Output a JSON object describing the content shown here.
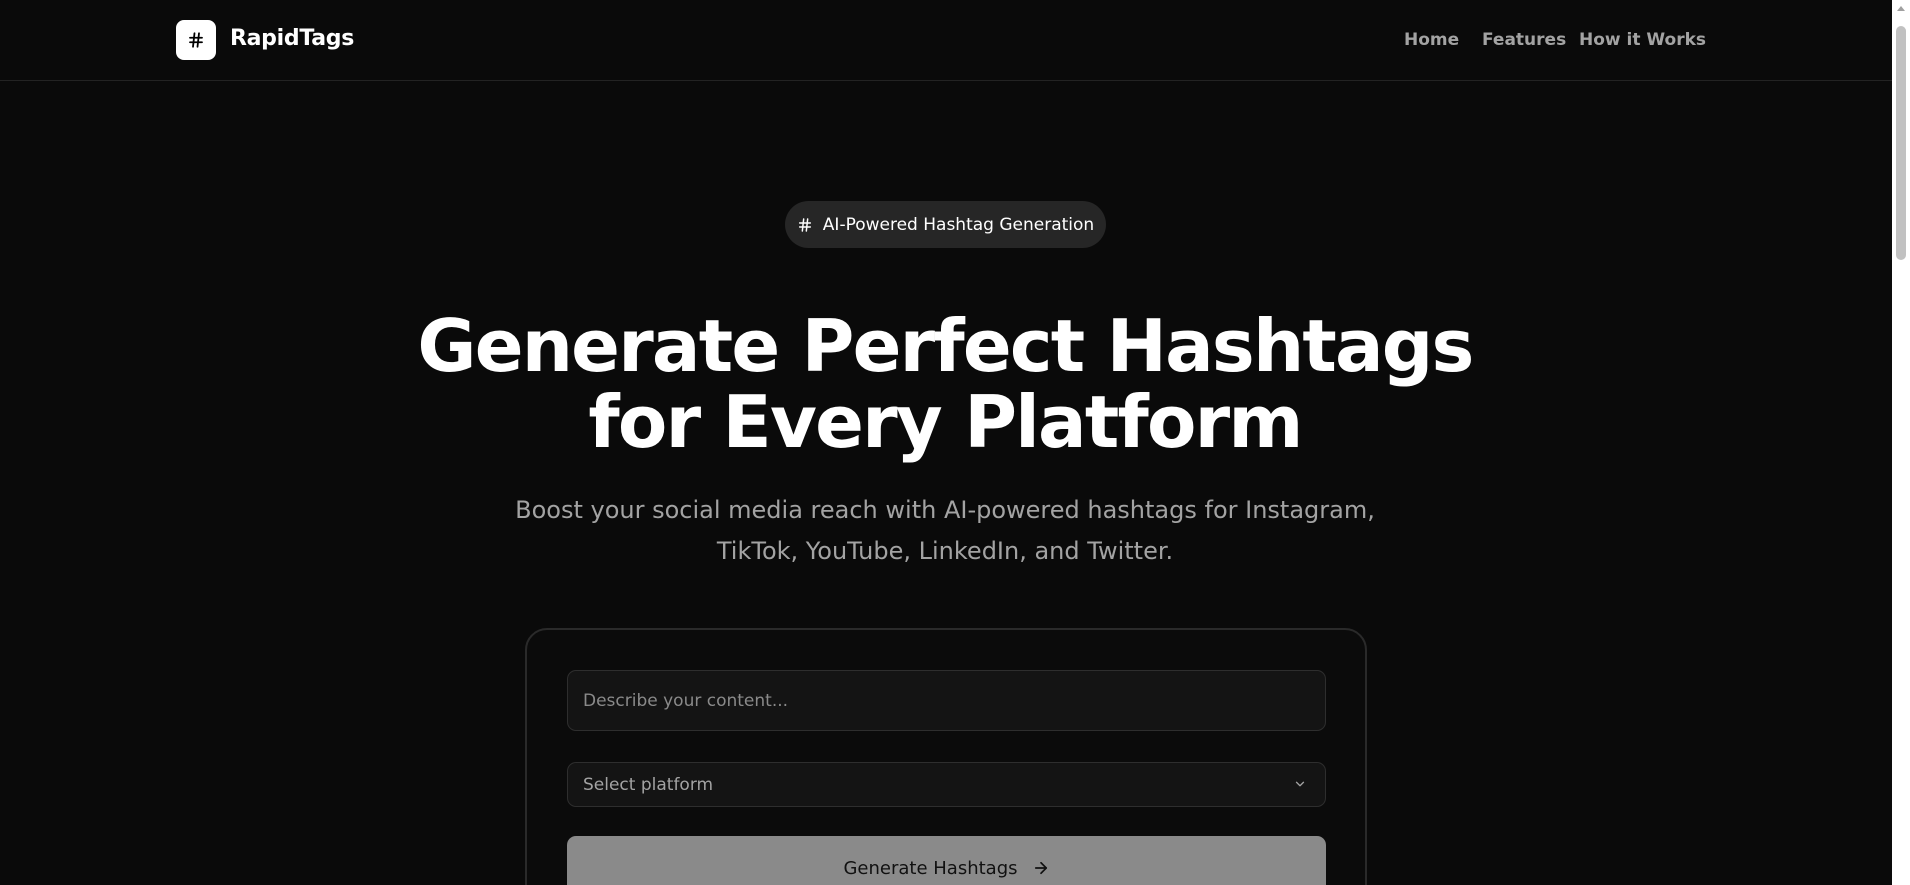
{
  "header": {
    "brand": "RapidTags",
    "logo_icon": "hash-icon",
    "nav": [
      {
        "label": "Home"
      },
      {
        "label": "Features"
      },
      {
        "label": "How it Works"
      }
    ]
  },
  "badge": {
    "icon": "hash-icon",
    "label": "AI-Powered Hashtag Generation"
  },
  "hero": {
    "title_line1": "Generate Perfect Hashtags",
    "title_line2": "for Every Platform",
    "subtitle_line1": "Boost your social media reach with AI-powered hashtags for Instagram,",
    "subtitle_line2": "TikTok, YouTube, LinkedIn, and Twitter."
  },
  "form": {
    "content_placeholder": "Describe your content...",
    "platform_placeholder": "Select platform",
    "generate_label": "Generate Hashtags"
  },
  "colors": {
    "background": "#0a0a0a",
    "text_primary": "#ffffff",
    "text_muted": "#a3a3a3",
    "button_bg": "#8a8a8a"
  }
}
